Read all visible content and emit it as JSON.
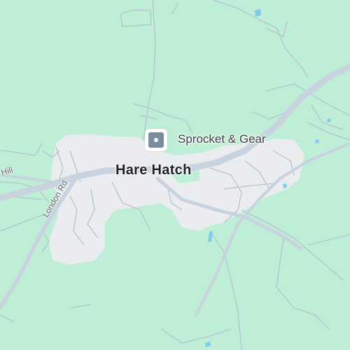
{
  "map": {
    "town_name": "Hare Hatch",
    "poi": {
      "name": "Sprocket & Gear",
      "icon": "shop-icon"
    },
    "road_labels": {
      "london_rd": "London Rd",
      "hill": "Hill"
    },
    "colors": {
      "land": "#bfeed6",
      "urban": "#ebecef",
      "road": "#c7d3de",
      "minor_road": "#b4c3cf",
      "water": "#7ecbf0",
      "poi_icon": "#7b8c9c"
    }
  }
}
